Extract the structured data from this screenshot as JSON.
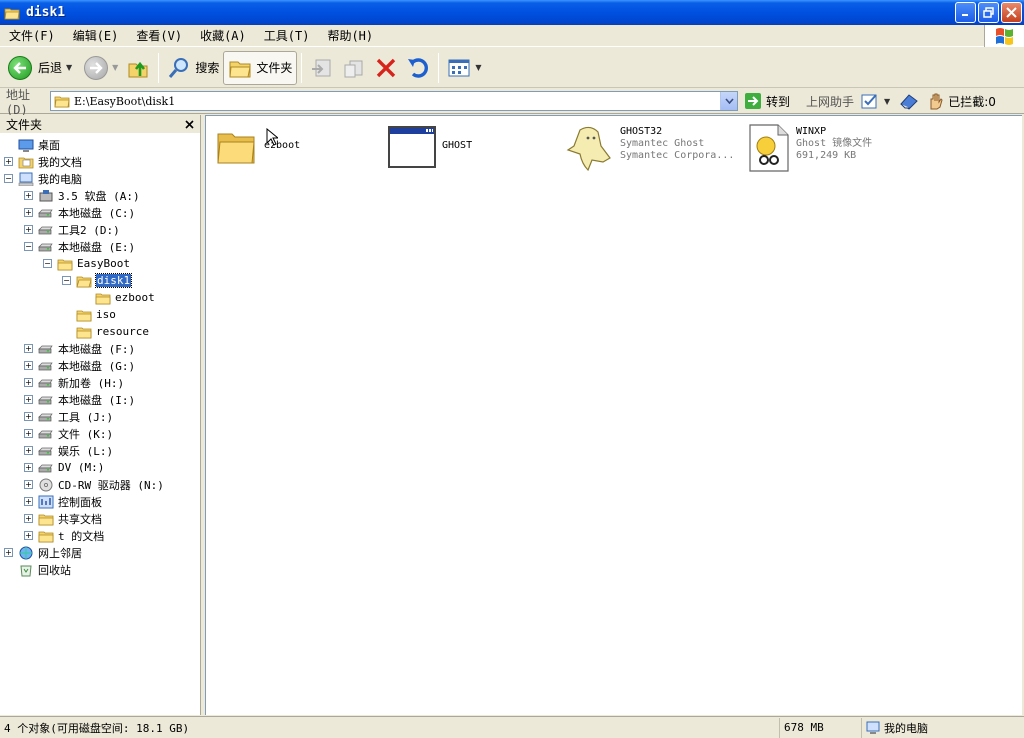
{
  "window": {
    "title": "disk1"
  },
  "menu": [
    "文件(F)",
    "编辑(E)",
    "查看(V)",
    "收藏(A)",
    "工具(T)",
    "帮助(H)"
  ],
  "toolbar": {
    "back_label": "后退",
    "search_label": "搜索",
    "folders_label": "文件夹"
  },
  "address": {
    "label": "地址(D)",
    "value": "E:\\EasyBoot\\disk1",
    "go_label": "转到",
    "helper_label": "上网助手",
    "blocked_label": "已拦截:0"
  },
  "folder_pane": {
    "title": "文件夹",
    "tree": [
      {
        "label": "桌面",
        "icon": "desktop-icon"
      },
      {
        "label": "我的文档",
        "icon": "my-documents-icon"
      },
      {
        "label": "我的电脑",
        "icon": "my-computer-icon"
      },
      {
        "label": "3.5 软盘 (A:)",
        "icon": "floppy-icon"
      },
      {
        "label": "本地磁盘 (C:)",
        "icon": "drive-icon"
      },
      {
        "label": "工具2 (D:)",
        "icon": "drive-icon"
      },
      {
        "label": "本地磁盘 (E:)",
        "icon": "drive-icon"
      },
      {
        "label": "EasyBoot",
        "icon": "folder-icon"
      },
      {
        "label": "disk1",
        "icon": "folder-open-icon"
      },
      {
        "label": "ezboot",
        "icon": "folder-icon"
      },
      {
        "label": "iso",
        "icon": "folder-icon"
      },
      {
        "label": "resource",
        "icon": "folder-icon"
      },
      {
        "label": "本地磁盘 (F:)",
        "icon": "drive-icon"
      },
      {
        "label": "本地磁盘 (G:)",
        "icon": "drive-icon"
      },
      {
        "label": "新加卷 (H:)",
        "icon": "drive-icon"
      },
      {
        "label": "本地磁盘 (I:)",
        "icon": "drive-icon"
      },
      {
        "label": "工具 (J:)",
        "icon": "drive-icon"
      },
      {
        "label": "文件 (K:)",
        "icon": "drive-icon"
      },
      {
        "label": "娱乐 (L:)",
        "icon": "drive-icon"
      },
      {
        "label": "DV (M:)",
        "icon": "drive-icon"
      },
      {
        "label": "CD-RW 驱动器 (N:)",
        "icon": "cdrom-icon"
      },
      {
        "label": "控制面板",
        "icon": "control-panel-icon"
      },
      {
        "label": "共享文档",
        "icon": "folder-icon"
      },
      {
        "label": "t 的文档",
        "icon": "folder-icon"
      },
      {
        "label": "网上邻居",
        "icon": "network-icon"
      },
      {
        "label": "回收站",
        "icon": "recycle-bin-icon"
      }
    ]
  },
  "files": [
    {
      "name": "ezboot",
      "icon": "folder-icon",
      "lines": []
    },
    {
      "name": "GHOST",
      "icon": "application-window-icon",
      "lines": []
    },
    {
      "name": "GHOST32",
      "icon": "ghost-icon",
      "lines": [
        "Symantec Ghost",
        "Symantec Corpora..."
      ]
    },
    {
      "name": "WINXP",
      "icon": "ghost-image-file-icon",
      "lines": [
        "Ghost 镜像文件",
        "691,249 KB"
      ]
    }
  ],
  "status": {
    "objects": "4 个对象(可用磁盘空间: 18.1 GB)",
    "size": "678 MB",
    "location": "我的电脑"
  },
  "colors": {
    "titlebar": "#0050e0",
    "selection": "#316ac5",
    "chrome": "#ece9d8"
  }
}
